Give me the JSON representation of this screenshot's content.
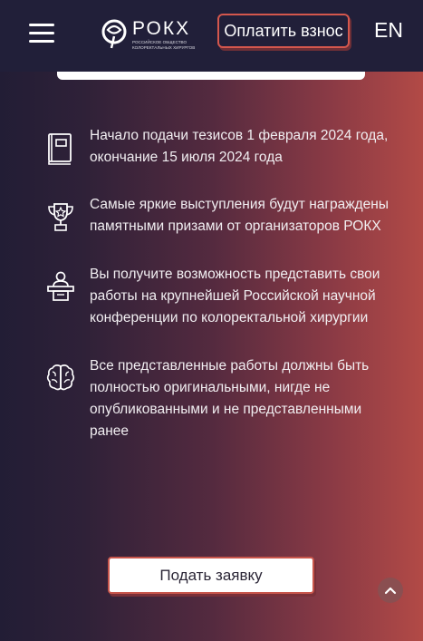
{
  "header": {
    "logo_text": "РОКХ",
    "logo_subtitle": "РОССИЙСКОЕ ОБЩЕСТВО КОЛОРЕКТАЛЬНЫХ ХИРУРГОВ",
    "pay_button": "Оплатить взнос",
    "lang": "EN"
  },
  "features": [
    {
      "icon": "book-icon",
      "text": "Начало подачи тезисов 1 февраля 2024 года, окончание 15 июля 2024 года"
    },
    {
      "icon": "trophy-icon",
      "text": "Самые яркие выступления будут награждены памятными призами от организаторов РОКХ"
    },
    {
      "icon": "speaker-podium-icon",
      "text": "Вы получите возможность представить свои работы на крупнейшей Российской научной конференции по колоректальной хирургии"
    },
    {
      "icon": "brain-icon",
      "text": "Все представленные работы должны быть полностью оригинальными, нигде не опубликованными и не представленными ранее"
    }
  ],
  "apply_button": "Подать заявку",
  "scroll_top_icon": "chevron-up-icon"
}
